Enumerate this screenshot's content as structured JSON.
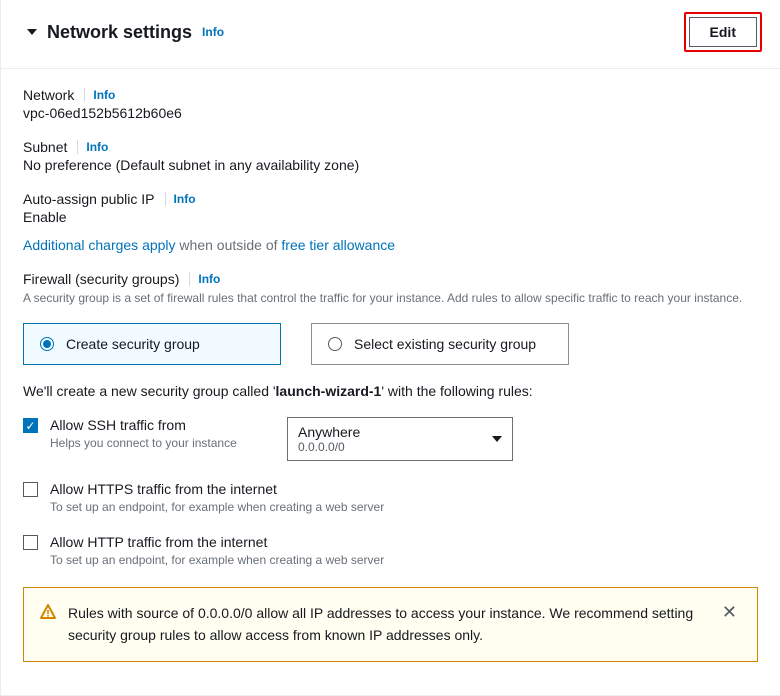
{
  "header": {
    "title": "Network settings",
    "info": "Info",
    "edit": "Edit"
  },
  "network": {
    "label": "Network",
    "info": "Info",
    "value": "vpc-06ed152b5612b60e6"
  },
  "subnet": {
    "label": "Subnet",
    "info": "Info",
    "value": "No preference (Default subnet in any availability zone)"
  },
  "publicIp": {
    "label": "Auto-assign public IP",
    "info": "Info",
    "value": "Enable"
  },
  "charges": {
    "link1": "Additional charges apply",
    "mid": " when outside of ",
    "link2": "free tier allowance"
  },
  "firewall": {
    "label": "Firewall (security groups)",
    "info": "Info",
    "desc": "A security group is a set of firewall rules that control the traffic for your instance. Add rules to allow specific traffic to reach your instance."
  },
  "sgOptions": {
    "create": "Create security group",
    "existing": "Select existing security group"
  },
  "sgNote": {
    "pre": "We'll create a new security group called '",
    "name": "launch-wizard-1",
    "post": "' with the following rules:"
  },
  "ssh": {
    "label": "Allow SSH traffic from",
    "desc": "Helps you connect to your instance",
    "dropMain": "Anywhere",
    "dropSub": "0.0.0.0/0"
  },
  "https": {
    "label": "Allow HTTPS traffic from the internet",
    "desc": "To set up an endpoint, for example when creating a web server"
  },
  "http": {
    "label": "Allow HTTP traffic from the internet",
    "desc": "To set up an endpoint, for example when creating a web server"
  },
  "warning": {
    "text": "Rules with source of 0.0.0.0/0 allow all IP addresses to access your instance. We recommend setting security group rules to allow access from known IP addresses only."
  }
}
